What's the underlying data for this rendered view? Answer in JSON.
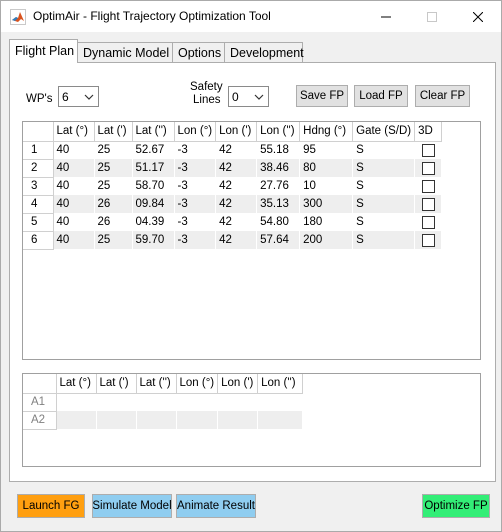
{
  "window": {
    "title": "OptimAir - Flight Trajectory Optimization Tool",
    "icon": "matlab-icon",
    "controls": {
      "minimize": "─",
      "maximize": "☐",
      "close": "✕"
    }
  },
  "tabs": [
    {
      "label": "Flight Plan",
      "active": true
    },
    {
      "label": "Dynamic Model",
      "active": false
    },
    {
      "label": "Options",
      "active": false
    },
    {
      "label": "Development",
      "active": false
    }
  ],
  "controls": {
    "wps_label": "WP's",
    "wps_value": "6",
    "safety_label_1": "Safety",
    "safety_label_2": "Lines",
    "safety_value": "0",
    "save_fp": "Save FP",
    "load_fp": "Load FP",
    "clear_fp": "Clear FP"
  },
  "waypoints_table": {
    "columns": [
      "Lat (°)",
      "Lat (')",
      "Lat ('')",
      "Lon (°)",
      "Lon (')",
      "Lon ('')",
      "Hdng (°)",
      "Gate (S/D)",
      "3D"
    ],
    "rows": [
      {
        "id": "1",
        "cells": [
          "40",
          "25",
          "52.67",
          "-3",
          "42",
          "55.18",
          "95",
          "S"
        ],
        "checked": false
      },
      {
        "id": "2",
        "cells": [
          "40",
          "25",
          "51.17",
          "-3",
          "42",
          "38.46",
          "80",
          "S"
        ],
        "checked": false
      },
      {
        "id": "3",
        "cells": [
          "40",
          "25",
          "58.70",
          "-3",
          "42",
          "27.76",
          "10",
          "S"
        ],
        "checked": false
      },
      {
        "id": "4",
        "cells": [
          "40",
          "26",
          "09.84",
          "-3",
          "42",
          "35.13",
          "300",
          "S"
        ],
        "checked": false
      },
      {
        "id": "5",
        "cells": [
          "40",
          "26",
          "04.39",
          "-3",
          "42",
          "54.80",
          "180",
          "S"
        ],
        "checked": false
      },
      {
        "id": "6",
        "cells": [
          "40",
          "25",
          "59.70",
          "-3",
          "42",
          "57.64",
          "200",
          "S"
        ],
        "checked": false
      }
    ]
  },
  "airports_table": {
    "columns": [
      "Lat (°)",
      "Lat (')",
      "Lat ('')",
      "Lon (°)",
      "Lon (')",
      "Lon ('')"
    ],
    "rows": [
      {
        "id": "A1",
        "cells": [
          "",
          "",
          "",
          "",
          "",
          ""
        ]
      },
      {
        "id": "A2",
        "cells": [
          "",
          "",
          "",
          "",
          "",
          ""
        ]
      }
    ]
  },
  "bottom_buttons": {
    "launch_fg": "Launch FG",
    "simulate_model": "Simulate Model",
    "animate_result": "Animate Result",
    "optimize_fp": "Optimize FP"
  },
  "colors": {
    "launch_fg": "#ff9f10",
    "simulate_model": "#8fcdf0",
    "animate_result": "#8fcdf0",
    "optimize_fp": "#33ee77",
    "even_row": "#eeeeee"
  }
}
